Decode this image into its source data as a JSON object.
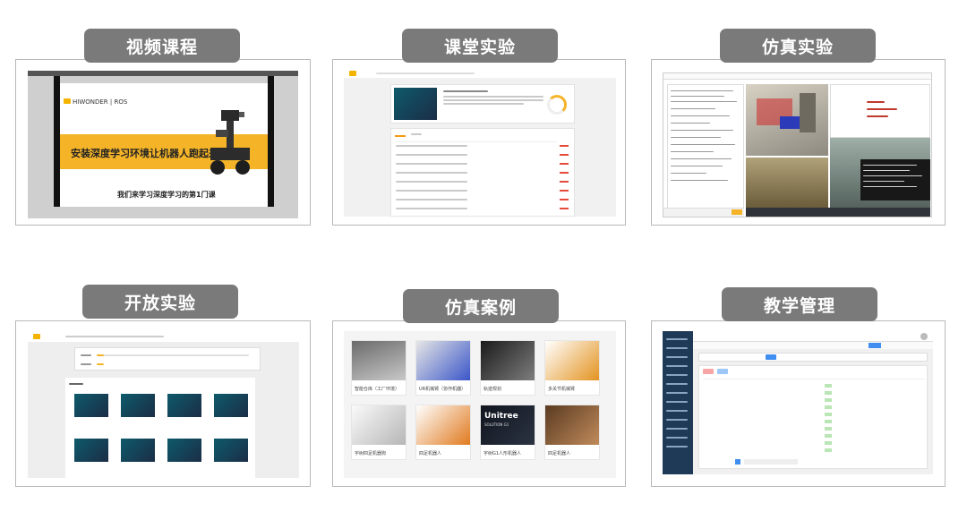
{
  "tiles": [
    {
      "label": "视频课程"
    },
    {
      "label": "课堂实验"
    },
    {
      "label": "仿真实验"
    },
    {
      "label": "开放实验"
    },
    {
      "label": "仿真案例"
    },
    {
      "label": "教学管理"
    }
  ],
  "video_course": {
    "logo_text": "HIWONDER | ROS",
    "slide_title": "安装深度学习环境让机器人跑起来",
    "slide_subtitle": "我们来学习深度学习的第1门课"
  },
  "sim_cases": [
    {
      "label": "智能仓库（工厂环境）"
    },
    {
      "label": "UR机械臂（协作机器）"
    },
    {
      "label": "轨迹规划"
    },
    {
      "label": "多关节机械臂"
    },
    {
      "label": "宇树四足机器狗"
    },
    {
      "label": "四足机器人"
    },
    {
      "label": "宇树G1人形机器人",
      "logo": "Unitree",
      "sub": "SOLUTION G1"
    },
    {
      "label": "四足机器人"
    }
  ],
  "colors": {
    "label_bg": "#7a7a7a",
    "accent_yellow": "#f5b428",
    "teal": "#0e5a6b",
    "admin_sidebar": "#1f3a57"
  }
}
